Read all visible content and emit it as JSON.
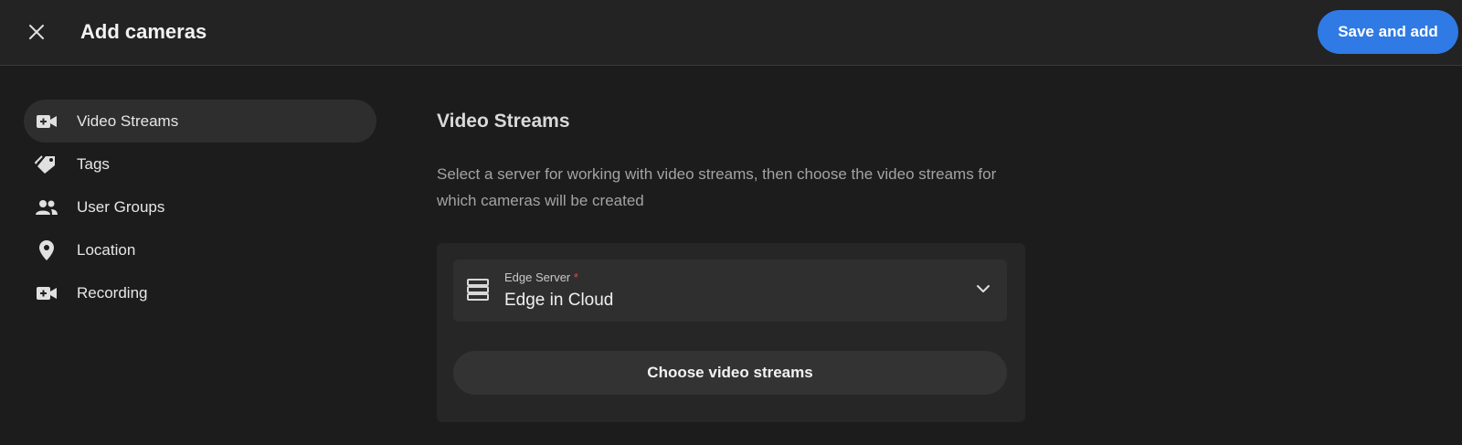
{
  "header": {
    "title": "Add cameras",
    "close_icon": "close-icon",
    "save_label": "Save and add"
  },
  "sidebar": {
    "items": [
      {
        "label": "Video Streams",
        "icon": "video-camera-icon",
        "active": true
      },
      {
        "label": "Tags",
        "icon": "tags-icon",
        "active": false
      },
      {
        "label": "User Groups",
        "icon": "user-group-icon",
        "active": false
      },
      {
        "label": "Location",
        "icon": "location-pin-icon",
        "active": false
      },
      {
        "label": "Recording",
        "icon": "video-camera-icon",
        "active": false
      }
    ]
  },
  "main": {
    "title": "Video Streams",
    "description": "Select a server for working with video streams, then choose the video streams for which cameras will be created",
    "server_select": {
      "label": "Edge Server",
      "required_mark": "*",
      "value": "Edge in Cloud",
      "icon": "server-icon"
    },
    "choose_button_label": "Choose video streams"
  },
  "colors": {
    "accent": "#2f7ae5",
    "background": "#1c1c1c",
    "required": "#e5484d"
  }
}
